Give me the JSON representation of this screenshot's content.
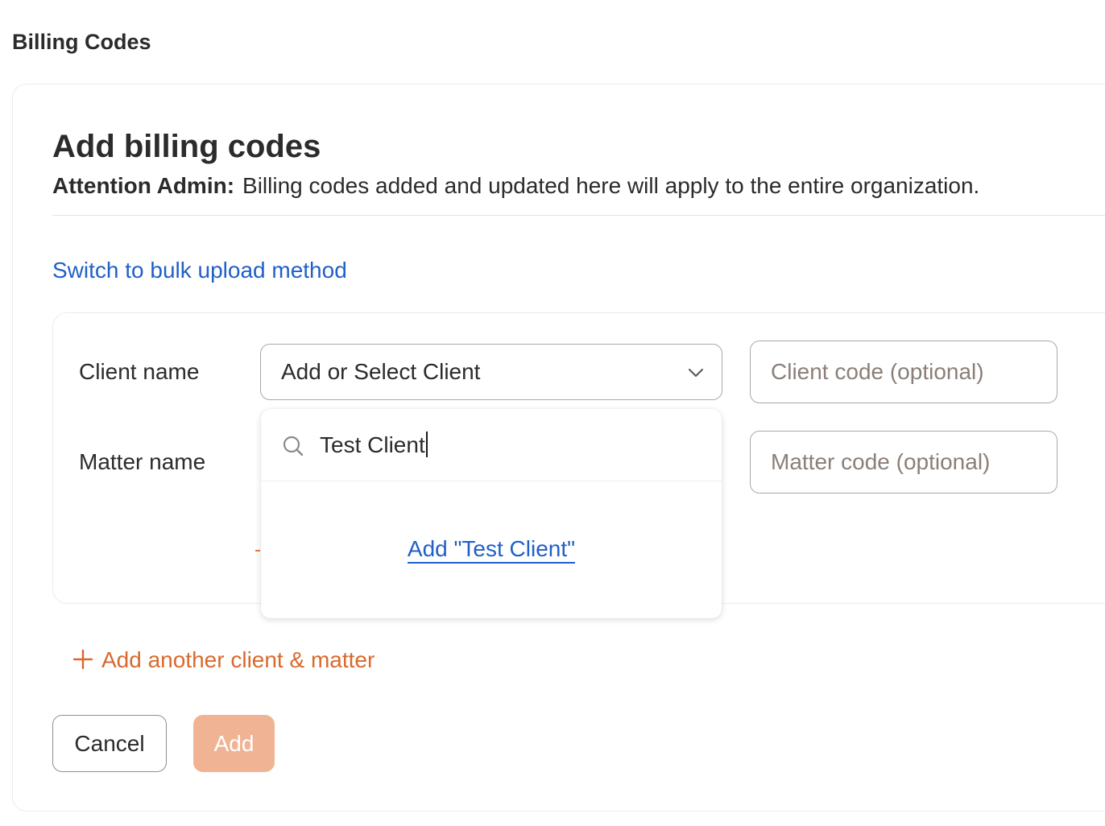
{
  "page": {
    "title": "Billing Codes"
  },
  "form": {
    "title": "Add billing codes",
    "attention_label": "Attention Admin:",
    "attention_text": "Billing codes added and updated here will apply to the entire organization.",
    "bulk_link": "Switch to bulk upload method",
    "client_label": "Client name",
    "matter_label": "Matter name",
    "client_select_value": "Add or Select Client",
    "client_code_placeholder": "Client code (optional)",
    "matter_code_placeholder": "Matter code (optional)"
  },
  "dropdown": {
    "search_value": "Test Client",
    "add_option": "Add \"Test Client\""
  },
  "actions": {
    "add_another": "Add another client & matter",
    "cancel": "Cancel",
    "add": "Add"
  },
  "colors": {
    "accent_orange": "#d9692c",
    "link_blue": "#2060c8",
    "add_button_disabled": "#f0b494"
  },
  "icons": {
    "select_chevron": "chevron-down-icon",
    "search": "search-icon",
    "add_another": "plus-icon"
  }
}
